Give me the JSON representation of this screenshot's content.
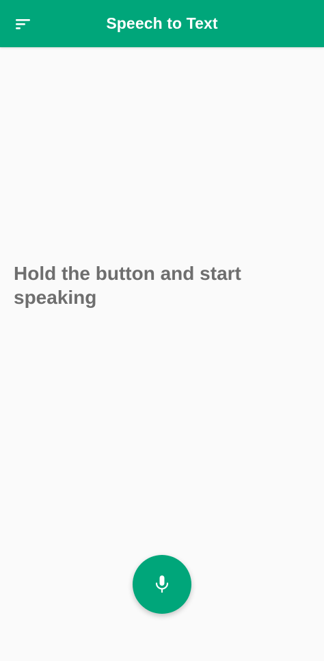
{
  "appbar": {
    "title": "Speech to Text",
    "menu_icon": "sort-menu-icon",
    "background_color": "#00a67a"
  },
  "main": {
    "prompt_text": "Hold the button and start speaking"
  },
  "mic_button": {
    "icon": "microphone-icon",
    "color": "#00a67a"
  }
}
